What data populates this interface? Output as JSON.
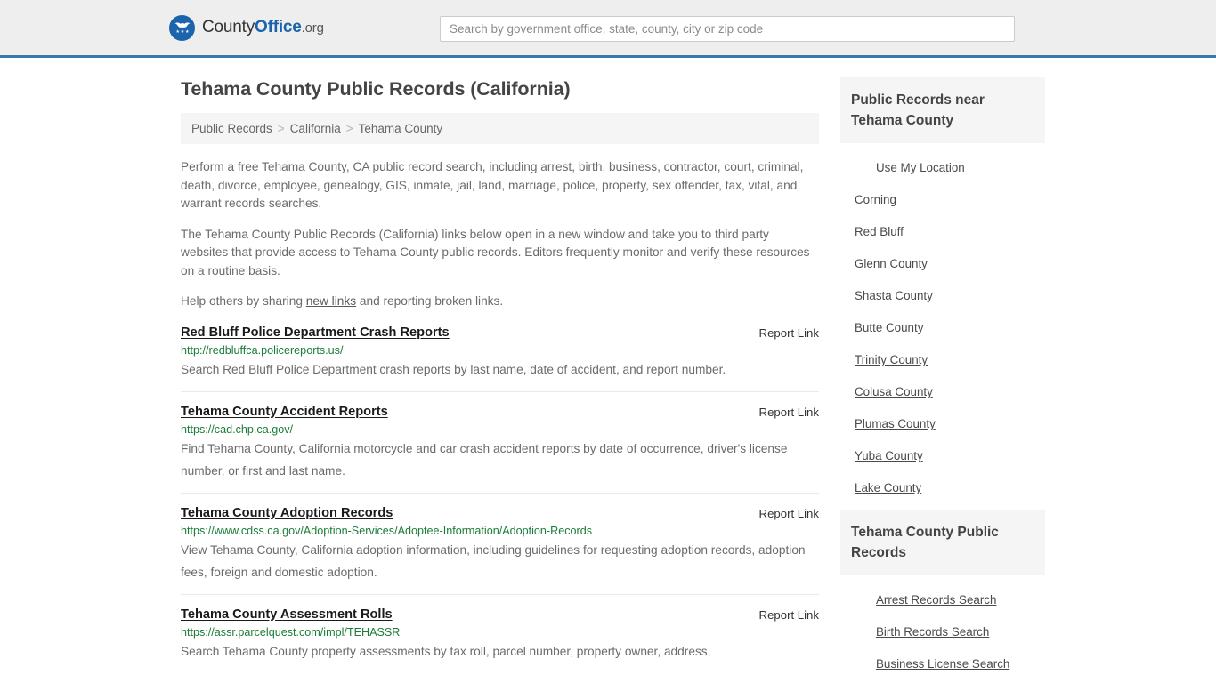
{
  "header": {
    "brand": {
      "part1": "County",
      "part2": "Office",
      "part3": ".org"
    },
    "search": {
      "placeholder": "Search by government office, state, county, city or zip code",
      "value": ""
    }
  },
  "page": {
    "title": "Tehama County Public Records (California)"
  },
  "breadcrumb": {
    "items": [
      "Public Records",
      "California",
      "Tehama County"
    ],
    "separator": ">"
  },
  "intro": {
    "p1": "Perform a free Tehama County, CA public record search, including arrest, birth, business, contractor, court, criminal, death, divorce, employee, genealogy, GIS, inmate, jail, land, marriage, police, property, sex offender, tax, vital, and warrant records searches.",
    "p2": "The Tehama County Public Records (California) links below open in a new window and take you to third party websites that provide access to Tehama County public records. Editors frequently monitor and verify these resources on a routine basis.",
    "p3_before": "Help others by sharing ",
    "p3_link": "new links",
    "p3_after": " and reporting broken links."
  },
  "report_link_label": "Report Link",
  "results": [
    {
      "title": "Red Bluff Police Department Crash Reports",
      "url": "http://redbluffca.policereports.us/",
      "description": "Search Red Bluff Police Department crash reports by last name, date of accident, and report number."
    },
    {
      "title": "Tehama County Accident Reports",
      "url": "https://cad.chp.ca.gov/",
      "description": "Find Tehama County, California motorcycle and car crash accident reports by date of occurrence, driver's license number, or first and last name."
    },
    {
      "title": "Tehama County Adoption Records",
      "url": "https://www.cdss.ca.gov/Adoption-Services/Adoptee-Information/Adoption-Records",
      "description": "View Tehama County, California adoption information, including guidelines for requesting adoption records, adoption fees, foreign and domestic adoption."
    },
    {
      "title": "Tehama County Assessment Rolls",
      "url": "https://assr.parcelquest.com/impl/TEHASSR",
      "description": "Search Tehama County property assessments by tax roll, parcel number, property owner, address,"
    }
  ],
  "sidebar": {
    "nearby": {
      "heading": "Public Records near Tehama County",
      "items": [
        {
          "label": "Use My Location",
          "indent": true
        },
        {
          "label": "Corning",
          "indent": false
        },
        {
          "label": "Red Bluff",
          "indent": false
        },
        {
          "label": "Glenn County",
          "indent": false
        },
        {
          "label": "Shasta County",
          "indent": false
        },
        {
          "label": "Butte County",
          "indent": false
        },
        {
          "label": "Trinity County",
          "indent": false
        },
        {
          "label": "Colusa County",
          "indent": false
        },
        {
          "label": "Plumas County",
          "indent": false
        },
        {
          "label": "Yuba County",
          "indent": false
        },
        {
          "label": "Lake County",
          "indent": false
        }
      ]
    },
    "records": {
      "heading": "Tehama County Public Records",
      "items": [
        {
          "label": "Arrest Records Search"
        },
        {
          "label": "Birth Records Search"
        },
        {
          "label": "Business License Search"
        }
      ]
    }
  },
  "colors": {
    "header_bg": "#eeeeee",
    "header_rule": "#3a77ac",
    "brand_blue": "#1b63ad",
    "url_green": "#1a7d37",
    "panel_gray": "#f5f5f5",
    "body_text": "#6b6b6b"
  }
}
